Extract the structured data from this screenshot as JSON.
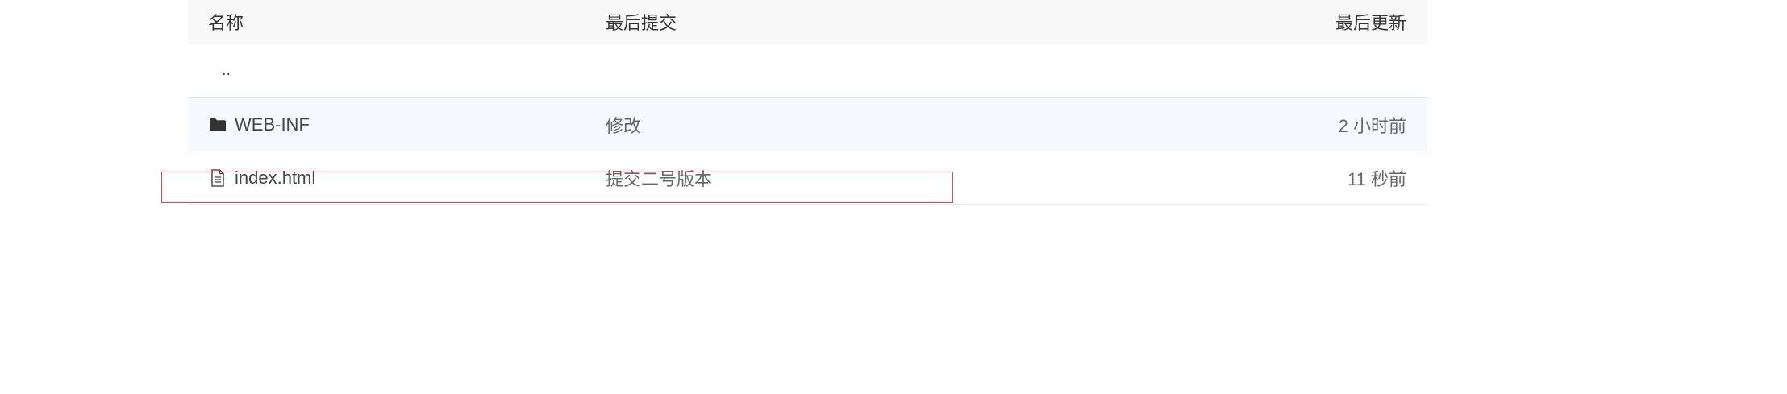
{
  "header": {
    "name_label": "名称",
    "commit_label": "最后提交",
    "updated_label": "最后更新"
  },
  "rows": [
    {
      "name": "..",
      "type": "parent",
      "commit": "",
      "updated": ""
    },
    {
      "name": "WEB-INF",
      "type": "folder",
      "icon": "folder-icon",
      "commit": "修改",
      "updated": "2 小时前"
    },
    {
      "name": "index.html",
      "type": "file",
      "icon": "file-text-icon",
      "commit": "提交二号版本",
      "updated": "11 秒前"
    }
  ],
  "focus_outline_color": "#e0454f"
}
